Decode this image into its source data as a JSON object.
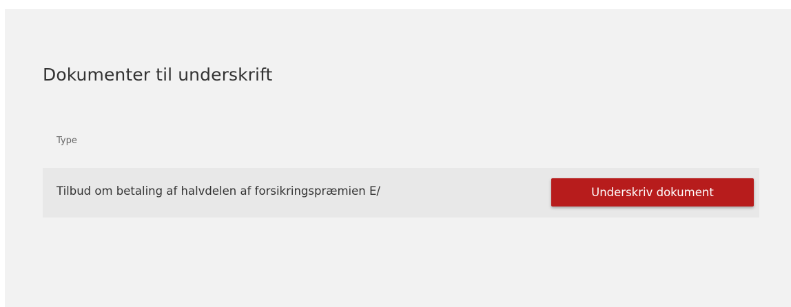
{
  "page": {
    "title": "Dokumenter til underskrift"
  },
  "table": {
    "column_header": "Type",
    "rows": [
      {
        "document_name": "Tilbud om betaling af halvdelen af forsikringspræmien E/",
        "action_label": "Underskriv dokument"
      }
    ]
  },
  "colors": {
    "panel_background": "#f2f2f2",
    "row_background": "#e8e8e8",
    "button_background": "#b71c1c",
    "button_text": "#ffffff"
  }
}
